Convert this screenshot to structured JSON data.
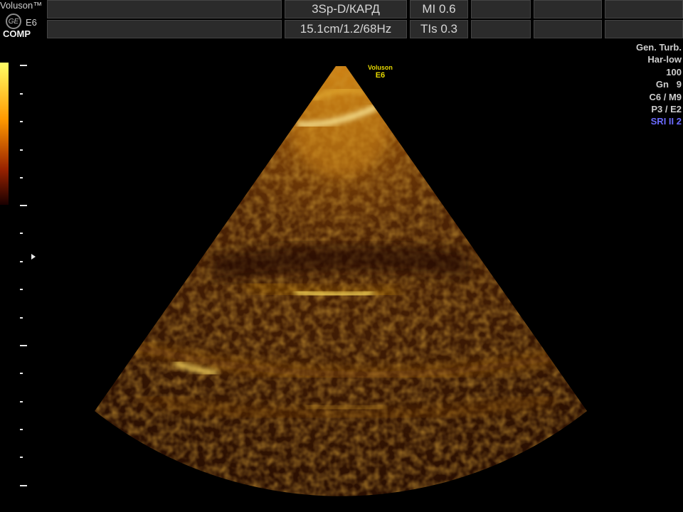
{
  "header": {
    "brand": "Voluson™",
    "logo_text": "GE",
    "model": "E6",
    "mode": "COMP",
    "probe_preset": "3Sp-D/КАРД",
    "mi": "MI  0.6",
    "depth_info": "15.1cm/1.2/68Hz",
    "tis": "TIs  0.3"
  },
  "watermark": {
    "line1": "Voluson",
    "line2": "E6"
  },
  "params": {
    "preset": "Gen. Turb.",
    "harmonic": "Har-low",
    "power": "100",
    "gain": "Gn   9",
    "crs_map": "C6 / M9",
    "persist": "P3 / E2",
    "sri": "SRI II 2"
  },
  "colors": {
    "sri_text": "#6b6bff",
    "tint_bright": "#ffe066",
    "tint_dark": "#3a1300"
  },
  "icons": {
    "logo": "ge-logo-icon",
    "focus": "focus-marker-icon"
  }
}
